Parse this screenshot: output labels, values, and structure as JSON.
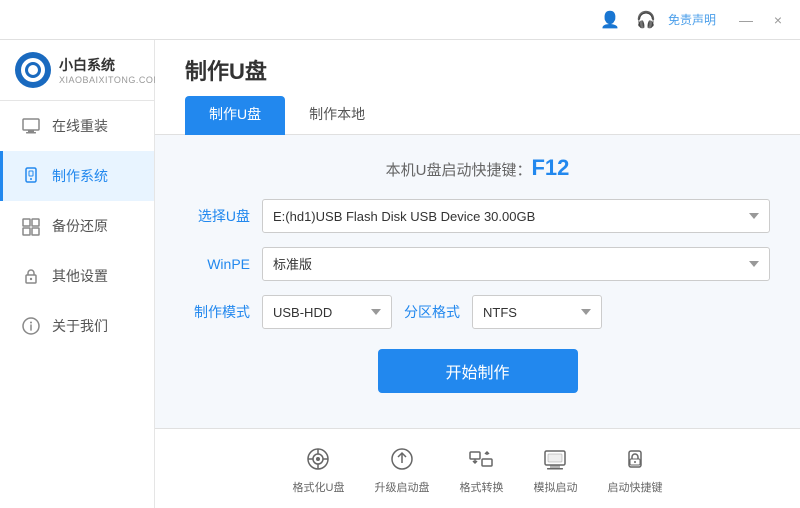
{
  "titleBar": {
    "disclaimer": "免责声明",
    "minimize": "—",
    "close": "×"
  },
  "logo": {
    "name": "小白系统",
    "domain": "XIAOBAIXITONG.COM"
  },
  "sidebar": {
    "items": [
      {
        "id": "online-reinstall",
        "label": "在线重装",
        "icon": "🖥"
      },
      {
        "id": "make-system",
        "label": "制作系统",
        "icon": "💾",
        "active": true
      },
      {
        "id": "backup-restore",
        "label": "备份还原",
        "icon": "📋"
      },
      {
        "id": "other-settings",
        "label": "其他设置",
        "icon": "🔒"
      },
      {
        "id": "about-us",
        "label": "关于我们",
        "icon": "ℹ"
      }
    ]
  },
  "page": {
    "title": "制作U盘",
    "tabs": [
      {
        "id": "make-usb",
        "label": "制作U盘",
        "active": true
      },
      {
        "id": "make-local",
        "label": "制作本地",
        "active": false
      }
    ],
    "shortcutHint": {
      "prefix": "本机U盘启动快捷键：",
      "key": "F12"
    },
    "form": {
      "usbLabel": "选择U盘",
      "usbValue": "E:(hd1)USB Flash Disk USB Device 30.00GB",
      "winpeLabel": "WinPE",
      "winpeValue": "标准版",
      "modeLabel": "制作模式",
      "modeValue": "USB-HDD",
      "partLabel": "分区格式",
      "partValue": "NTFS"
    },
    "startButton": "开始制作"
  },
  "bottomTools": [
    {
      "id": "format-usb",
      "label": "格式化U盘",
      "icon": "⊙"
    },
    {
      "id": "upgrade-boot",
      "label": "升级启动盘",
      "icon": "⊕"
    },
    {
      "id": "format-conv",
      "label": "格式转换",
      "icon": "⇄"
    },
    {
      "id": "sim-boot",
      "label": "模拟启动",
      "icon": "⌨"
    },
    {
      "id": "boot-hotkey",
      "label": "启动快捷键",
      "icon": "🔒"
    }
  ]
}
